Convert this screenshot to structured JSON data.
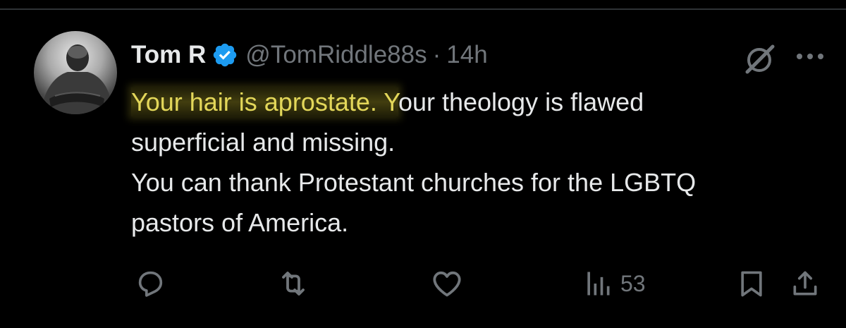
{
  "tweet": {
    "display_name": "Tom R",
    "verified": true,
    "handle": "@TomRiddle88s",
    "separator": "·",
    "time": "14h",
    "text": {
      "line1_highlight": "Your hair is aprostate. Y",
      "line1_rest": "our theology is flawed",
      "line2": "superficial and missing.",
      "line3": "You can thank Protestant churches for the LGBTQ",
      "line4": "pastors of America."
    },
    "highlight_color": "#e3d75a",
    "views": "53"
  },
  "icons": {
    "verified": "verified-badge-icon",
    "grok": "grok-icon",
    "more": "more-dots-icon",
    "reply": "reply-icon",
    "retweet": "retweet-icon",
    "like": "heart-icon",
    "views": "views-bar-chart-icon",
    "bookmark": "bookmark-icon",
    "share": "share-icon"
  },
  "colors": {
    "background": "#000000",
    "text": "#e7e9ea",
    "secondary": "#71767b",
    "verified_blue": "#1d9bf0",
    "divider": "#2f3336"
  }
}
